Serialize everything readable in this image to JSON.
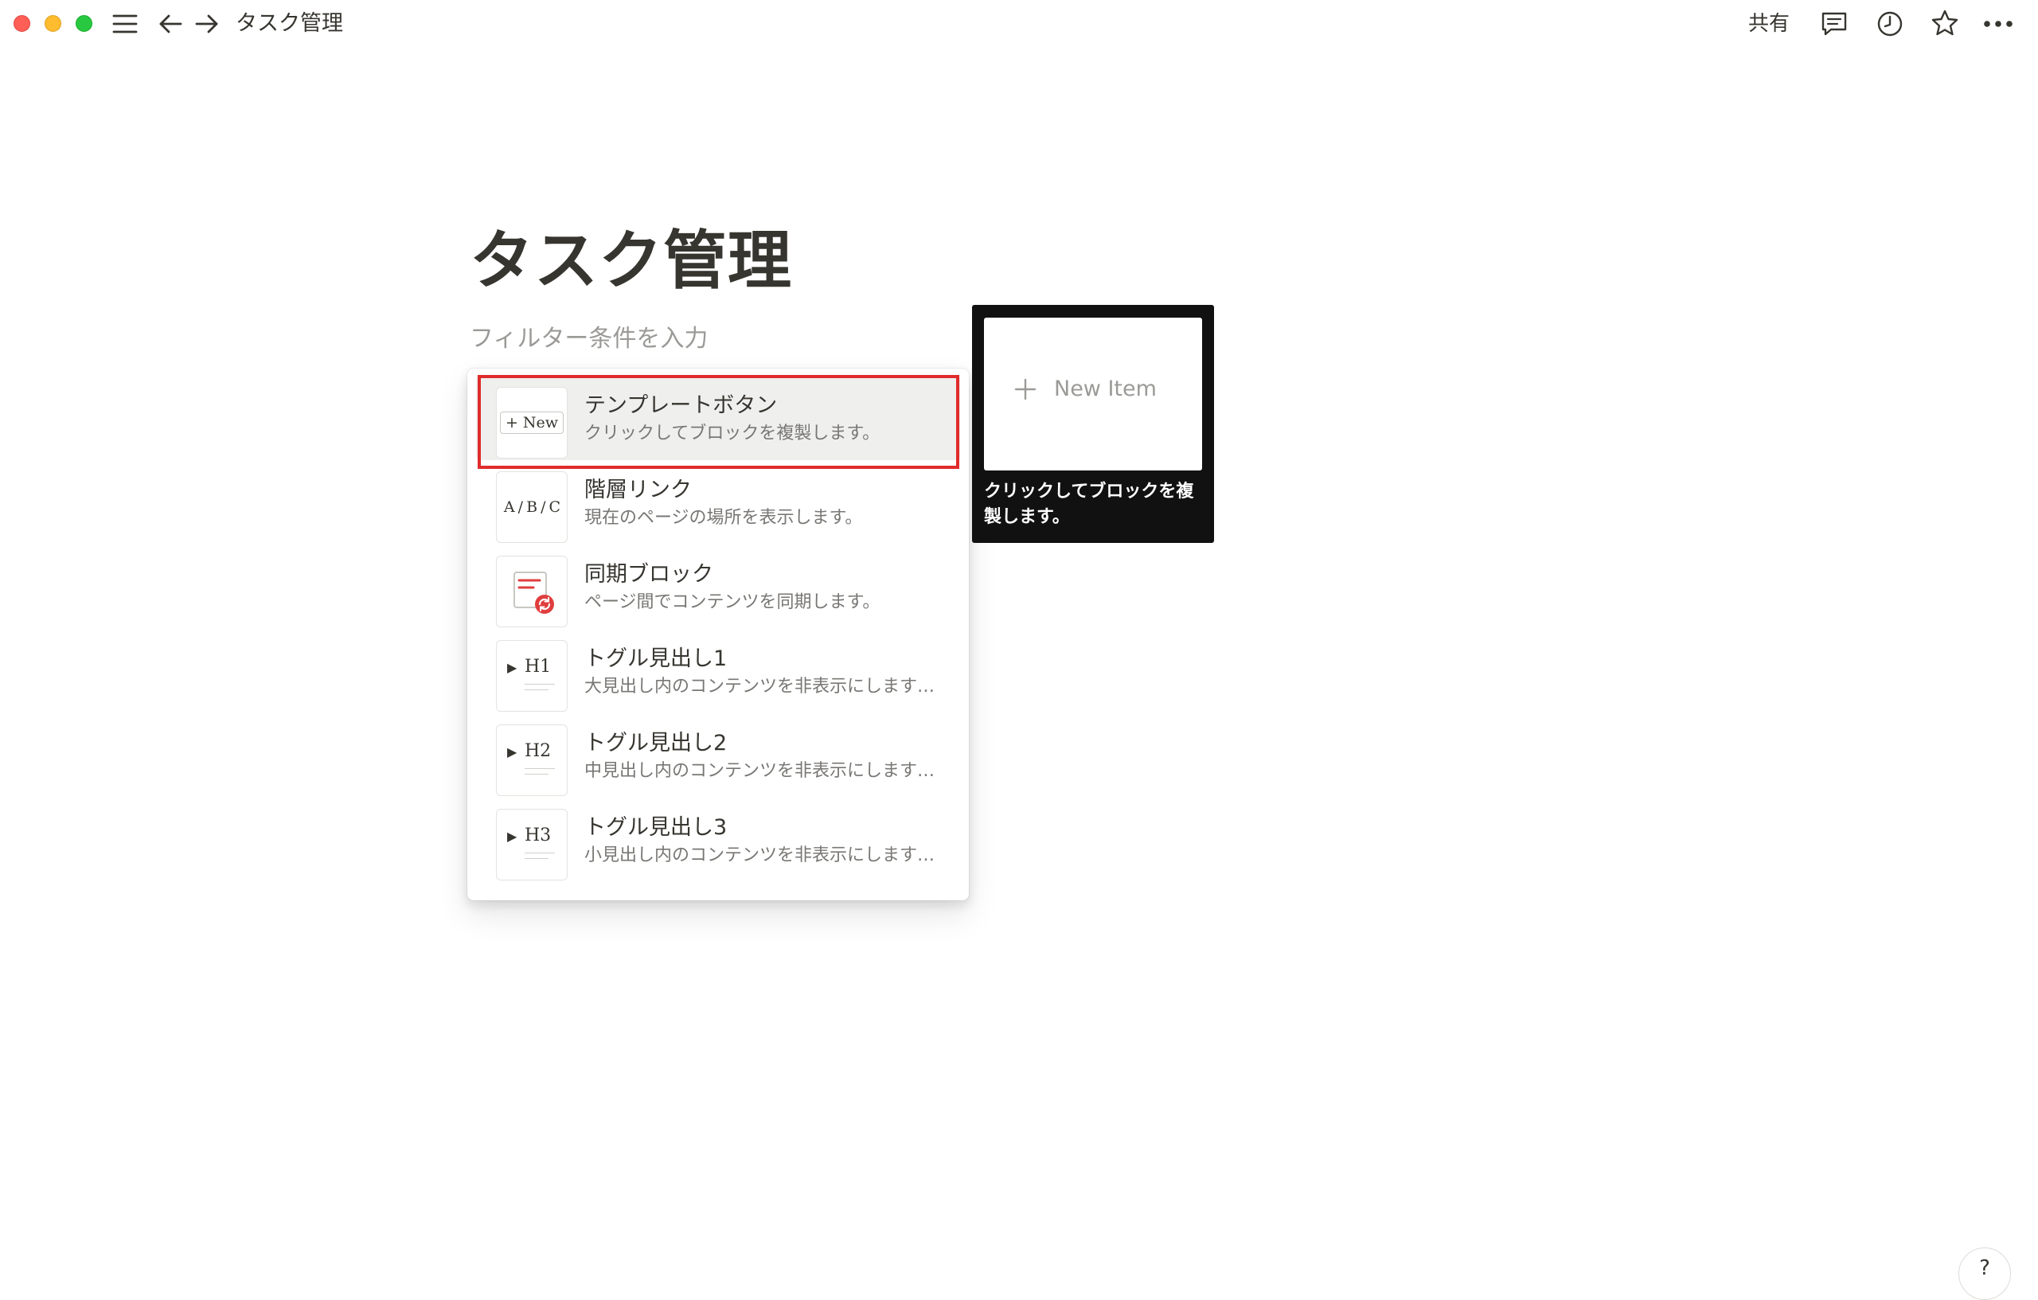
{
  "topbar": {
    "breadcrumb_title": "タスク管理",
    "share_label": "共有"
  },
  "page": {
    "title": "タスク管理",
    "filter_placeholder": "フィルター条件を入力"
  },
  "menu": {
    "items": [
      {
        "title": "テンプレートボタン",
        "description": "クリックしてブロックを複製します。",
        "icon": "template-button-icon",
        "icon_text": "+ New",
        "selected": true
      },
      {
        "title": "階層リンク",
        "description": "現在のページの場所を表示します。",
        "icon": "breadcrumb-icon",
        "icon_text": "A / B / C"
      },
      {
        "title": "同期ブロック",
        "description": "ページ間でコンテンツを同期します。",
        "icon": "synced-block-icon"
      },
      {
        "title": "トグル見出し1",
        "description": "大見出し内のコンテンツを非表示にします…",
        "icon": "toggle-heading-1-icon",
        "icon_text": "H1"
      },
      {
        "title": "トグル見出し2",
        "description": "中見出し内のコンテンツを非表示にします…",
        "icon": "toggle-heading-2-icon",
        "icon_text": "H2"
      },
      {
        "title": "トグル見出し3",
        "description": "小見出し内のコンテンツを非表示にします…",
        "icon": "toggle-heading-3-icon",
        "icon_text": "H3"
      }
    ]
  },
  "preview": {
    "card_label": "New Item",
    "description": "クリックしてブロックを複製します。"
  },
  "help": {
    "label": "?"
  },
  "colors": {
    "text": "#37352f",
    "muted": "#787774",
    "highlight": "#e02b2b",
    "selected_bg": "#efefee",
    "preview_bg": "#111111",
    "synced_red": "#e03e3e"
  }
}
